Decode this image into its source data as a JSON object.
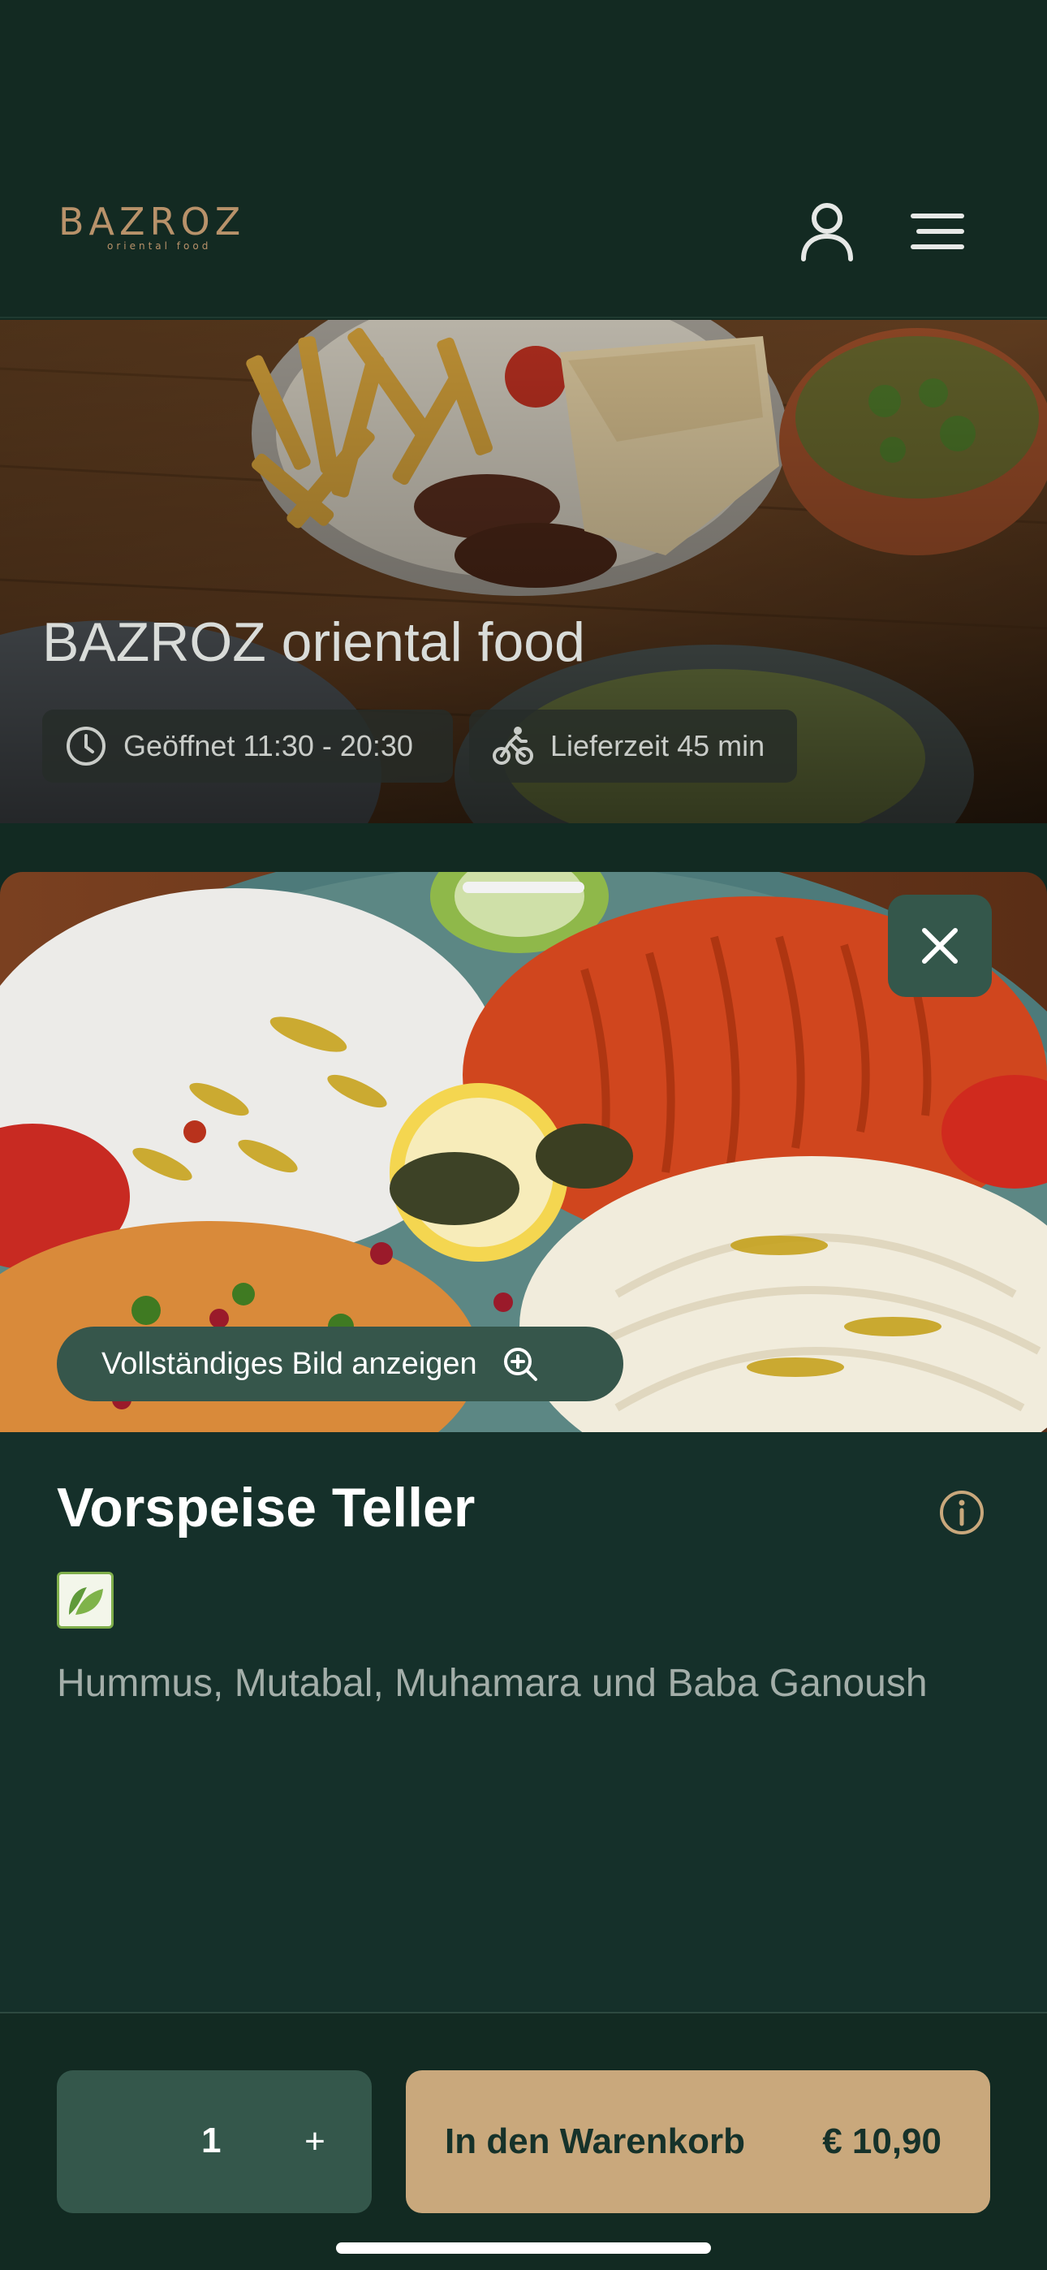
{
  "header": {
    "logo_main": "BAZROZ",
    "logo_sub": "oriental food",
    "account_icon": "person-icon",
    "menu_icon": "hamburger-icon"
  },
  "hero": {
    "title": "BAZROZ oriental food",
    "open_icon": "clock-icon",
    "open_text": "Geöffnet 11:30 - 20:30",
    "delivery_icon": "bicycle-icon",
    "delivery_text": "Lieferzeit 45 min"
  },
  "dish": {
    "close_icon": "close-icon",
    "view_full_label": "Vollständiges Bild anzeigen",
    "view_full_icon": "zoom-in-icon",
    "title": "Vorspeise Teller",
    "info_icon": "info-icon",
    "veg_icon": "leaf-icon",
    "description": "Hummus, Mutabal, Muhamara und Baba Ganoush"
  },
  "cart": {
    "quantity": "1",
    "plus_label": "+",
    "add_label": "In den Warenkorb",
    "price": "€ 10,90"
  },
  "colors": {
    "background": "#122a22",
    "sheet": "#15302a",
    "accent_gold": "#c9a87c",
    "button_green": "#34574b"
  }
}
